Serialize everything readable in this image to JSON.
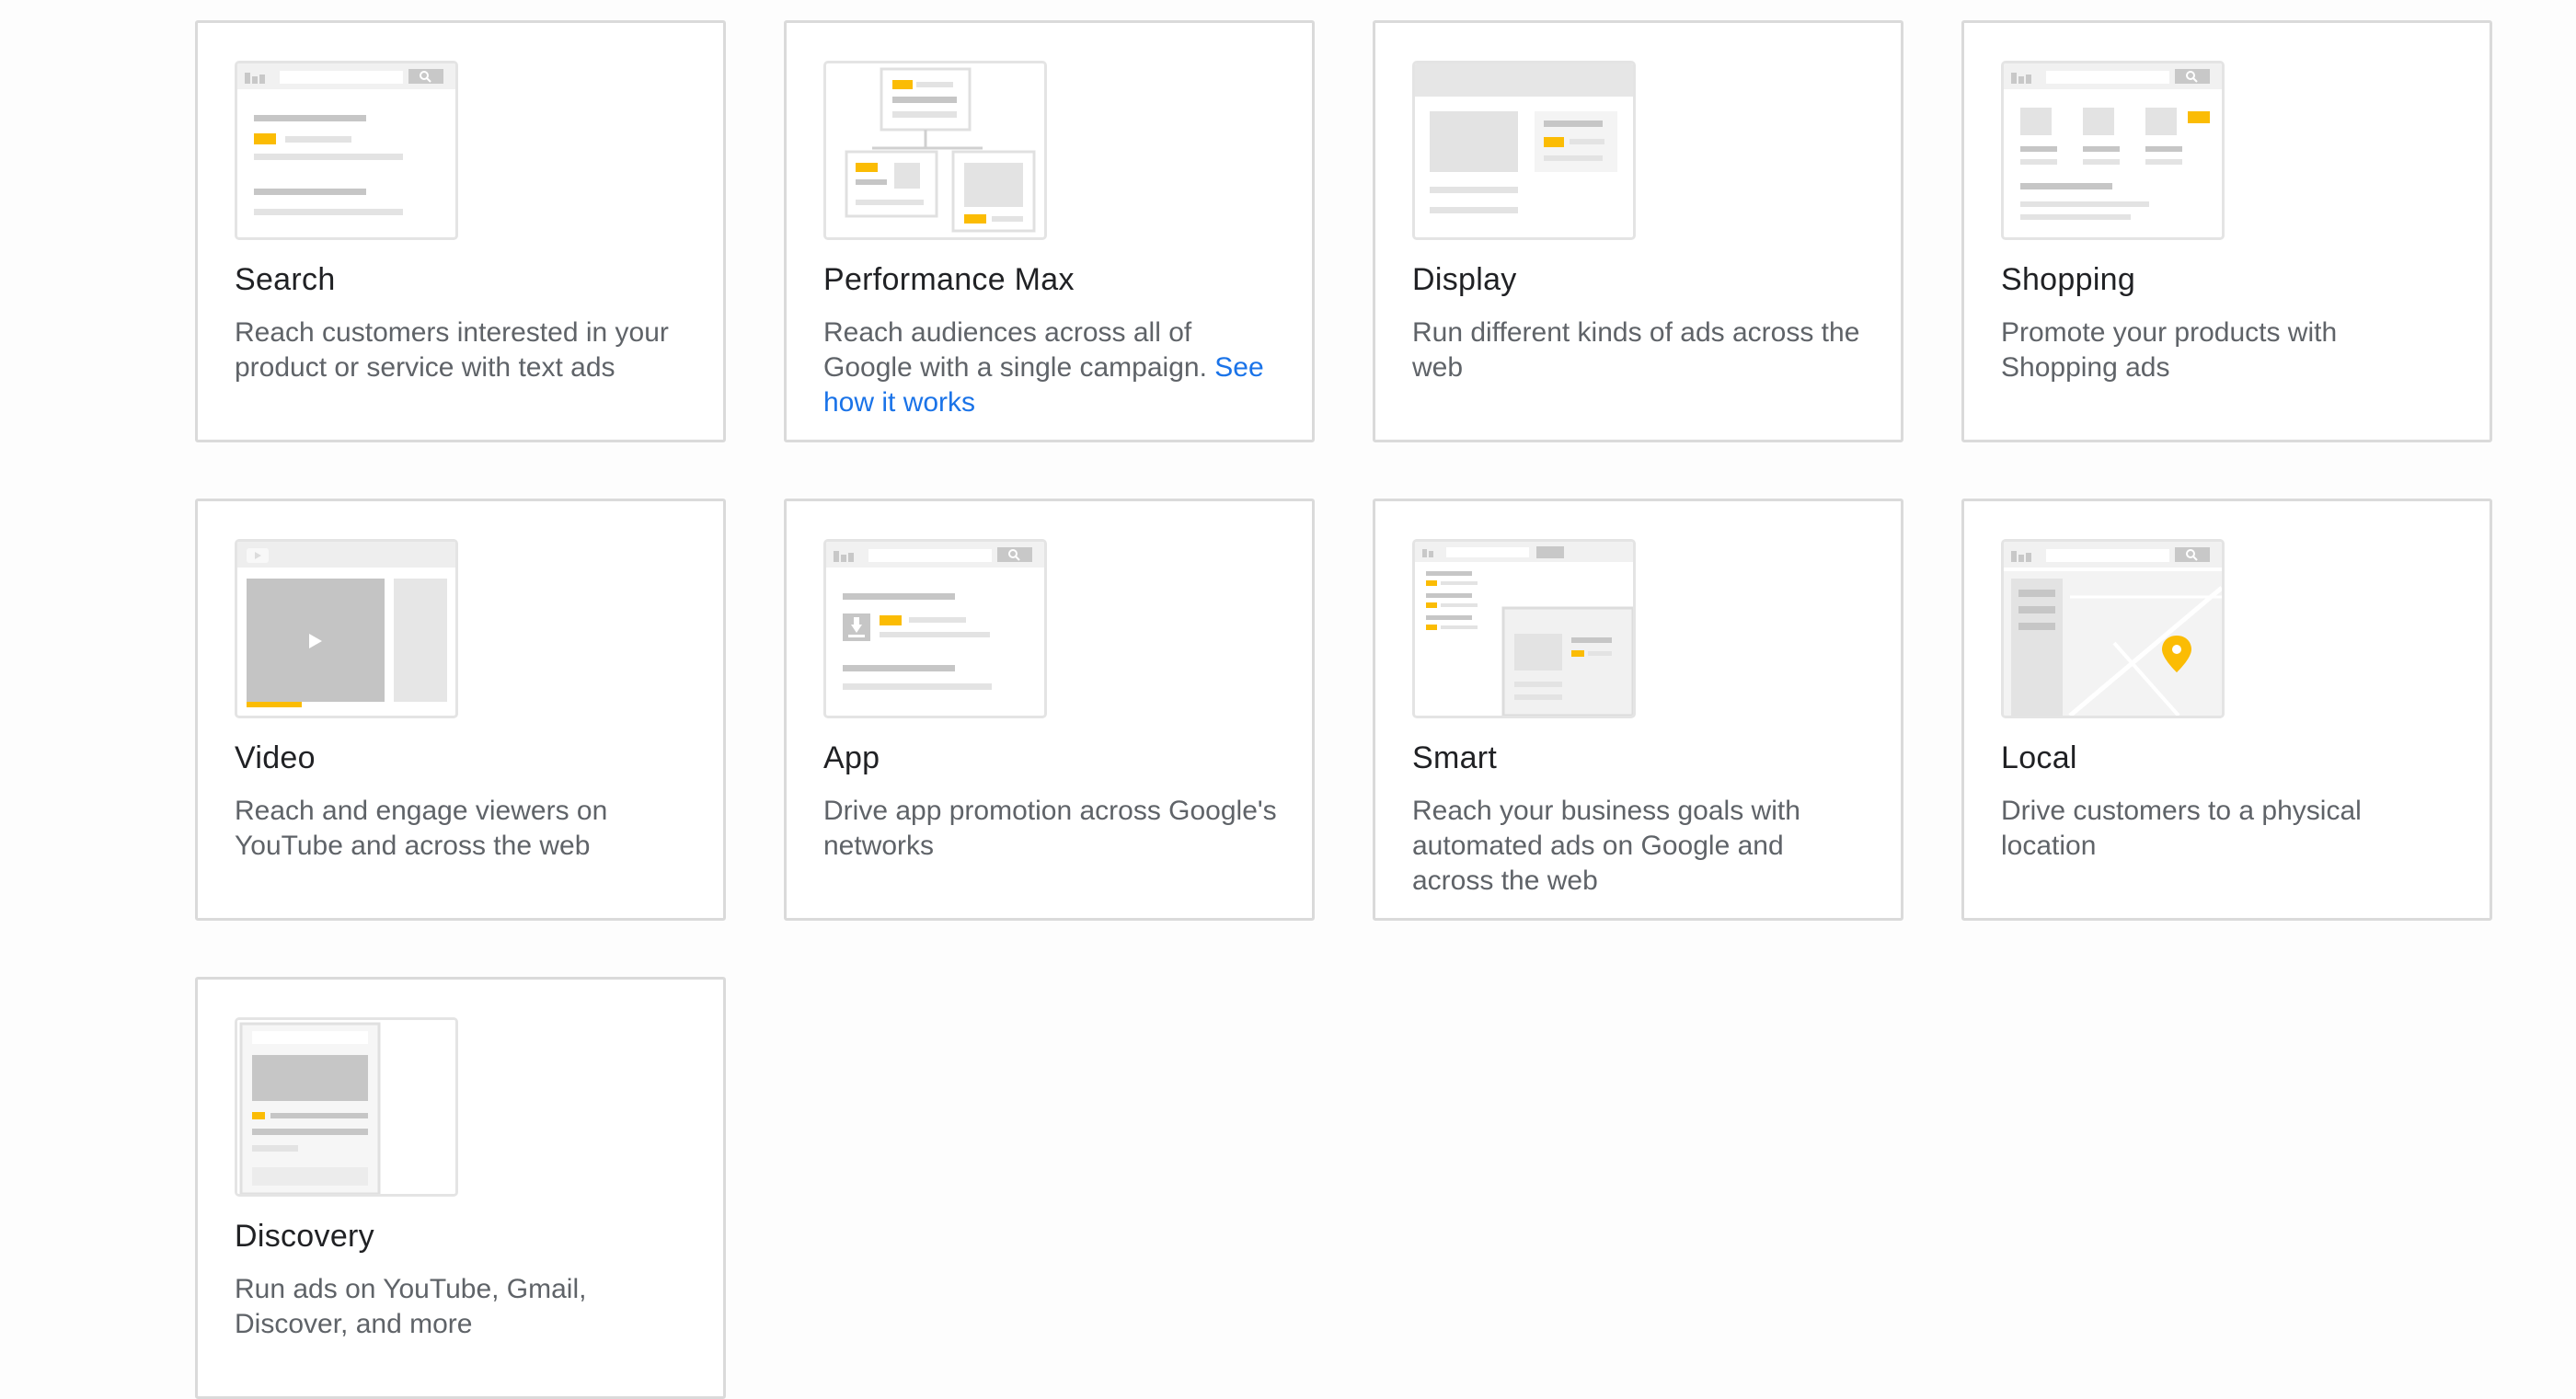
{
  "colors": {
    "accent": "#fbbc04",
    "link": "#1a73e8",
    "border": "#dadada",
    "placeholder_gray": "#dcdcdc"
  },
  "campaign_types": [
    {
      "id": "search",
      "title": "Search",
      "description": "Reach customers interested in your product or service with text ads"
    },
    {
      "id": "performance-max",
      "title": "Performance Max",
      "description": "Reach audiences across all of Google with a single campaign.",
      "link_text": "See how it works"
    },
    {
      "id": "display",
      "title": "Display",
      "description": "Run different kinds of ads across the web"
    },
    {
      "id": "shopping",
      "title": "Shopping",
      "description": "Promote your products with Shopping ads"
    },
    {
      "id": "video",
      "title": "Video",
      "description": "Reach and engage viewers on YouTube and across the web"
    },
    {
      "id": "app",
      "title": "App",
      "description": "Drive app promotion across Google's networks"
    },
    {
      "id": "smart",
      "title": "Smart",
      "description": "Reach your business goals with automated ads on Google and across the web"
    },
    {
      "id": "local",
      "title": "Local",
      "description": "Drive customers to a physical location"
    },
    {
      "id": "discovery",
      "title": "Discovery",
      "description": "Run ads on YouTube, Gmail, Discover, and more"
    }
  ]
}
